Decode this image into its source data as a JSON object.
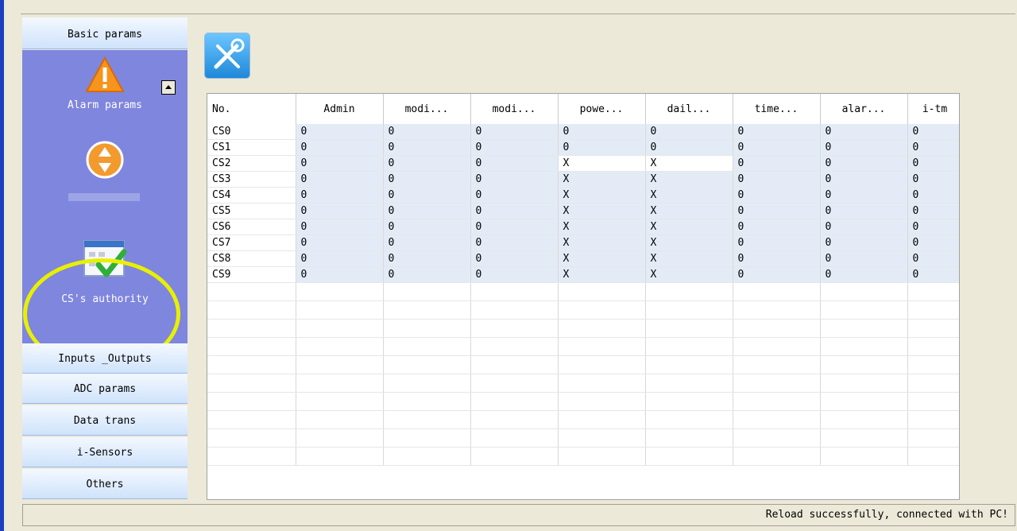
{
  "sidebar": {
    "sections": {
      "basic": "Basic params",
      "inputs_outputs": "Inputs _Outputs",
      "adc": "ADC params",
      "data_trans": "Data trans",
      "i_sensors": "i-Sensors",
      "others": "Others"
    },
    "panel_items": {
      "alarm": "Alarm params",
      "cs_authority": "CS's authority"
    }
  },
  "table": {
    "columns": [
      "No.",
      "Admin",
      "modi...",
      "modi...",
      "powe...",
      "dail...",
      "time...",
      "alar...",
      "i-tm"
    ],
    "rows": [
      [
        "CS0",
        "0",
        "0",
        "0",
        "0",
        "0",
        "0",
        "0",
        "0"
      ],
      [
        "CS1",
        "0",
        "0",
        "0",
        "0",
        "0",
        "0",
        "0",
        "0"
      ],
      [
        "CS2",
        "0",
        "0",
        "0",
        "X",
        "X",
        "0",
        "0",
        "0"
      ],
      [
        "CS3",
        "0",
        "0",
        "0",
        "X",
        "X",
        "0",
        "0",
        "0"
      ],
      [
        "CS4",
        "0",
        "0",
        "0",
        "X",
        "X",
        "0",
        "0",
        "0"
      ],
      [
        "CS5",
        "0",
        "0",
        "0",
        "X",
        "X",
        "0",
        "0",
        "0"
      ],
      [
        "CS6",
        "0",
        "0",
        "0",
        "X",
        "X",
        "0",
        "0",
        "0"
      ],
      [
        "CS7",
        "0",
        "0",
        "0",
        "X",
        "X",
        "0",
        "0",
        "0"
      ],
      [
        "CS8",
        "0",
        "0",
        "0",
        "X",
        "X",
        "0",
        "0",
        "0"
      ],
      [
        "CS9",
        "0",
        "0",
        "0",
        "X",
        "X",
        "0",
        "0",
        "0"
      ]
    ]
  },
  "status": {
    "message": "Reload successfully, connected with PC!"
  },
  "colors": {
    "sidebar_panel": "#7f86dd",
    "highlight": "#e8f000",
    "row_fill": "#e3ecf6",
    "frame_accent": "#1c3fbf"
  }
}
